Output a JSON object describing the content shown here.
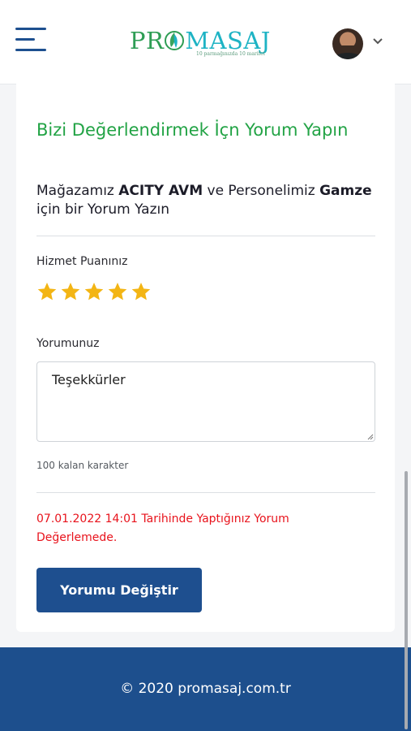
{
  "header": {
    "logo": {
      "part1": "PR",
      "part2": "MASAJ",
      "tagline": "10 parmağınızda 10 marifet"
    },
    "menu_icon": "hamburger-icon",
    "profile_icon": "user-avatar",
    "dropdown_icon": "chevron-down-icon"
  },
  "review": {
    "title": "Bizi Değerlendirmek İçn Yorum Yapın",
    "subtitle": {
      "prefix": "Mağazamız ",
      "store": "ACITY AVM",
      "middle": " ve Personelimiz ",
      "staff": "Gamze",
      "suffix": " için bir Yorum Yazın"
    },
    "rating_label": "Hizmet Puanınız",
    "rating_value": 5,
    "rating_max": 5,
    "comment_label": "Yorumunuz",
    "comment_value": "Teşekkürler",
    "chars_left_text": "100 kalan karakter",
    "status_message": "07.01.2022 14:01 Tarihinde Yaptığınız Yorum Değerlemede.",
    "submit_label": "Yorumu Değiştir"
  },
  "footer": {
    "copyright": "© 2020 promasaj.com.tr"
  },
  "colors": {
    "brand_blue": "#1e4f8f",
    "title_green": "#22a345",
    "star_gold": "#f3b514",
    "status_red": "#e8131c",
    "logo_green": "#2e9d54",
    "logo_teal": "#1db3c4"
  }
}
